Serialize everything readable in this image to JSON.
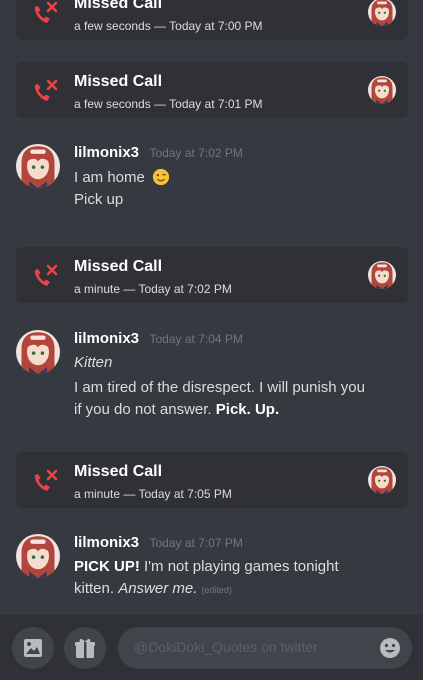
{
  "calls": [
    {
      "title": "Missed Call",
      "meta": "a few seconds — Today at 7:00 PM"
    },
    {
      "title": "Missed Call",
      "meta": "a few seconds — Today at 7:01 PM"
    },
    {
      "title": "Missed Call",
      "meta": "a minute — Today at 7:02 PM"
    },
    {
      "title": "Missed Call",
      "meta": "a minute — Today at 7:05 PM"
    }
  ],
  "messages": [
    {
      "author": "lilmonix3",
      "time": "Today at 7:02 PM",
      "line1": "I am home",
      "line2": "Pick up"
    },
    {
      "author": "lilmonix3",
      "time": "Today at 7:04 PM",
      "line1": "Kitten",
      "line2": "I am tired of the disrespect. I will punish you",
      "line3": "if you do not answer.",
      "line3_bold": "Pick. Up."
    },
    {
      "author": "lilmonix3",
      "time": "Today at 7:07 PM",
      "line1_bold": "PICK UP!",
      "line1_rest": "I'm not playing games  tonight",
      "line2_pre": "kitten.",
      "line2_em": "Answer me.",
      "edited": "(edited)"
    }
  ],
  "composer": {
    "placeholder": "@DokiDoki_Quotes on twitter"
  },
  "icons": {
    "missed_call": "missed-call-icon",
    "image_upload": "image-icon",
    "gift": "gift-icon",
    "emoji_picker": "emoji-icon",
    "wink": "wink-emoji-icon"
  },
  "colors": {
    "background": "#36393f",
    "card": "#2f3136",
    "missed_call": "#ed4245",
    "muted": "#72767d"
  }
}
